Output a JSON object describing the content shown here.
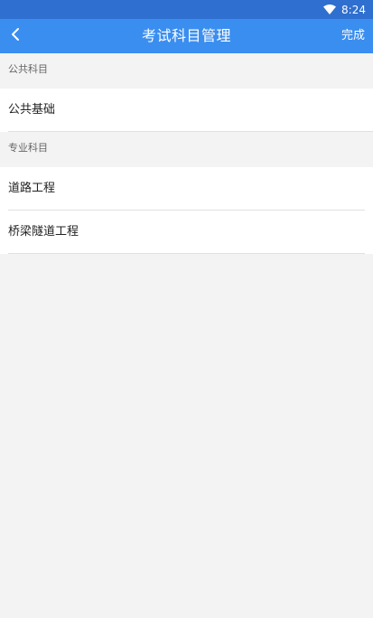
{
  "status_bar": {
    "time": "8:24",
    "icons": [
      "wifi-icon"
    ]
  },
  "app_bar": {
    "back_icon": "chevron-left-icon",
    "title": "考试科目管理",
    "done_label": "完成"
  },
  "sections": [
    {
      "header": "公共科目",
      "items": [
        {
          "label": "公共基础"
        }
      ]
    },
    {
      "header": "专业科目",
      "items": [
        {
          "label": "道路工程"
        },
        {
          "label": "桥梁隧道工程"
        }
      ]
    }
  ],
  "colors": {
    "status_bar": "#2f6fcf",
    "app_bar": "#3a8ef0",
    "background": "#f3f3f3",
    "divider": "#e1e1e1"
  }
}
